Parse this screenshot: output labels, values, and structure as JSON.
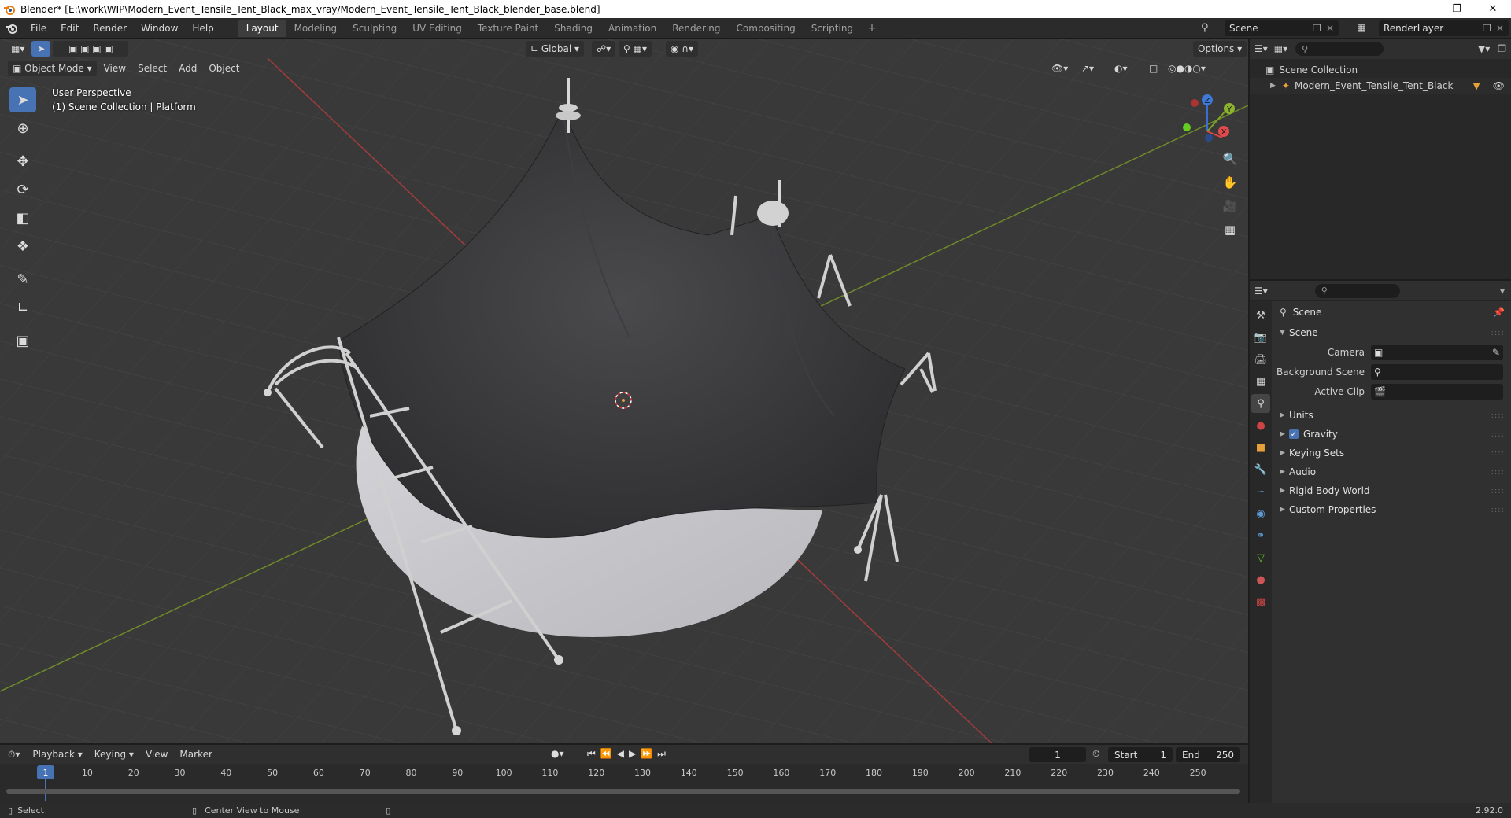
{
  "window": {
    "title": "Blender* [E:\\work\\WIP\\Modern_Event_Tensile_Tent_Black_max_vray/Modern_Event_Tensile_Tent_Black_blender_base.blend]",
    "minimize_icon": "minimize-icon",
    "maximize_icon": "restore-icon",
    "close_icon": "close-icon"
  },
  "menubar": {
    "items": [
      "File",
      "Edit",
      "Render",
      "Window",
      "Help"
    ],
    "workspaces": [
      "Layout",
      "Modeling",
      "Sculpting",
      "UV Editing",
      "Texture Paint",
      "Shading",
      "Animation",
      "Rendering",
      "Compositing",
      "Scripting"
    ],
    "active_workspace": "Layout",
    "add_tab": "+",
    "scene": "Scene",
    "render_layer": "RenderLayer"
  },
  "viewport": {
    "mode": "Object Mode",
    "menus": [
      "View",
      "Select",
      "Add",
      "Object"
    ],
    "orientation": "Global",
    "options_label": "Options",
    "overlay_line1": "User Perspective",
    "overlay_line2": "(1) Scene Collection | Platform",
    "gizmo": {
      "x": "X",
      "y": "Y",
      "z": "Z"
    }
  },
  "outliner": {
    "search_placeholder": "",
    "scene_collection": "Scene Collection",
    "object": "Modern_Event_Tensile_Tent_Black"
  },
  "properties": {
    "header_title": "Scene",
    "panel_scene": "Scene",
    "camera_label": "Camera",
    "background_scene_label": "Background Scene",
    "active_clip_label": "Active Clip",
    "panels": [
      "Units",
      "Gravity",
      "Keying Sets",
      "Audio",
      "Rigid Body World",
      "Custom Properties"
    ],
    "gravity_checked": true
  },
  "timeline": {
    "menus": [
      "Playback",
      "Keying",
      "View",
      "Marker"
    ],
    "current_frame": "1",
    "start_label": "Start",
    "start": "1",
    "end_label": "End",
    "end": "250",
    "ticks": [
      "1",
      "10",
      "20",
      "30",
      "40",
      "50",
      "60",
      "70",
      "80",
      "90",
      "100",
      "110",
      "120",
      "130",
      "140",
      "150",
      "160",
      "170",
      "180",
      "190",
      "200",
      "210",
      "220",
      "230",
      "240",
      "250"
    ]
  },
  "statusbar": {
    "left": "Select",
    "middle": "Center View to Mouse",
    "version": "2.92.0"
  },
  "colors": {
    "accent": "#4772b3",
    "viewport_bg": "#393939",
    "x_axis": "#b33a3a",
    "y_axis": "#7a9a2a"
  }
}
